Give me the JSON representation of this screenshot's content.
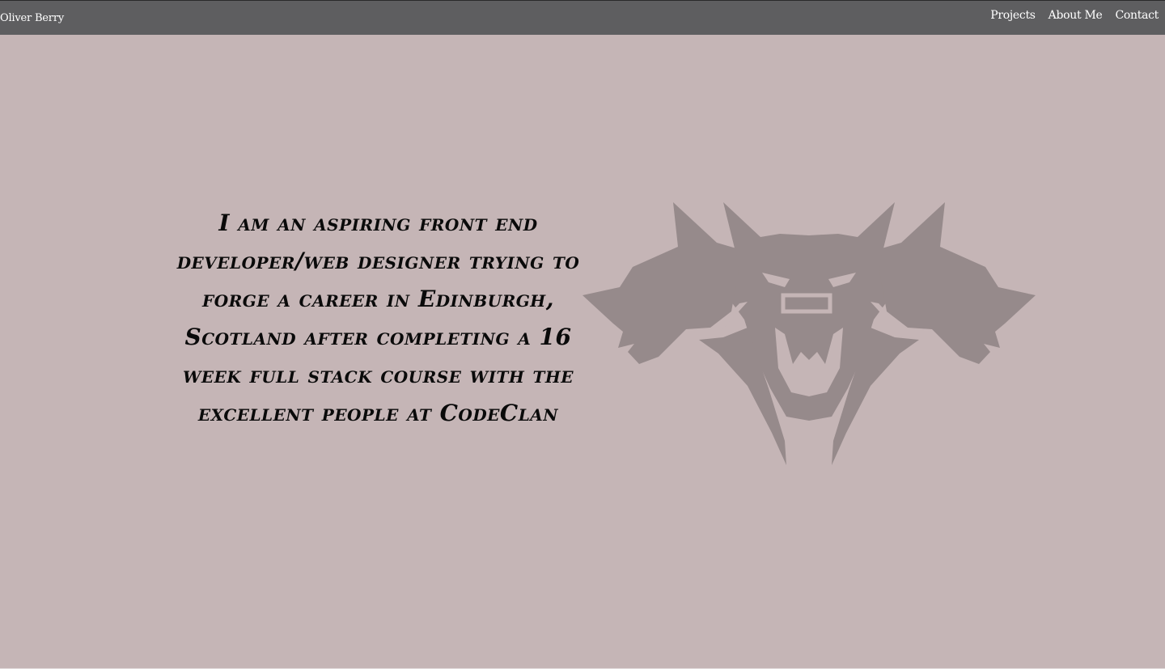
{
  "navbar": {
    "brand": "Oliver Berry",
    "links": [
      {
        "label": "Projects"
      },
      {
        "label": "About Me"
      },
      {
        "label": "Contact"
      }
    ]
  },
  "hero": {
    "text": "I am an aspiring front end developer/web designer trying to forge a career in Edinburgh, Scotland after completing a 16 week full stack course with the excellent people at CodeClan",
    "logo_icon": "three-headed-wolf-icon"
  },
  "colors": {
    "background": "#c5b5b6",
    "navbar": "#5e5e60",
    "logo": "#968a8b",
    "text": "#0a0a0a"
  }
}
